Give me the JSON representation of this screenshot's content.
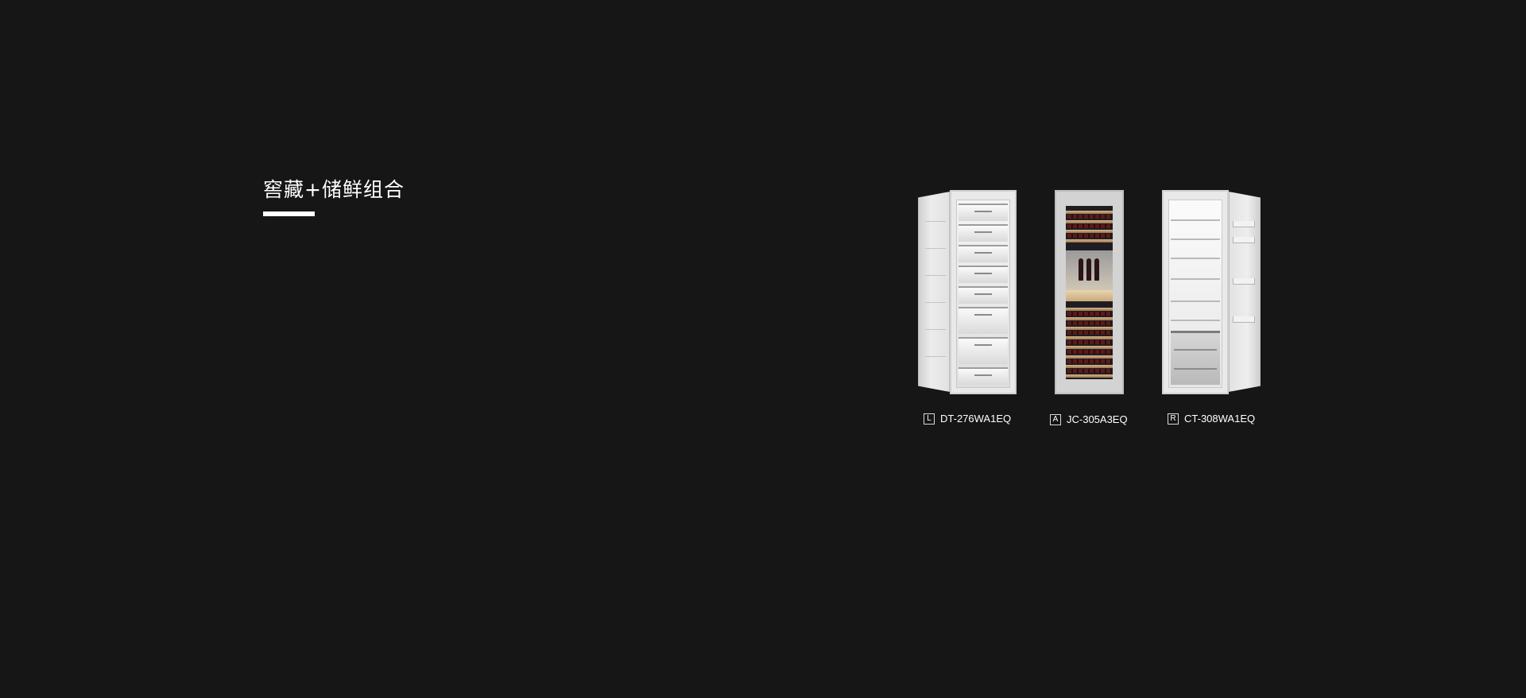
{
  "page": {
    "title": "窖藏+储鲜组合"
  },
  "products": [
    {
      "letter": "L",
      "model": "DT-276WA1EQ",
      "icon": "freezer-door-open-left-icon"
    },
    {
      "letter": "A",
      "model": "JC-305A3EQ",
      "icon": "wine-cabinet-icon"
    },
    {
      "letter": "R",
      "model": "CT-308WA1EQ",
      "icon": "refrigerator-door-open-right-icon"
    }
  ],
  "colors": {
    "background": "#161616",
    "text": "#ffffff",
    "underline": "#ffffff"
  }
}
